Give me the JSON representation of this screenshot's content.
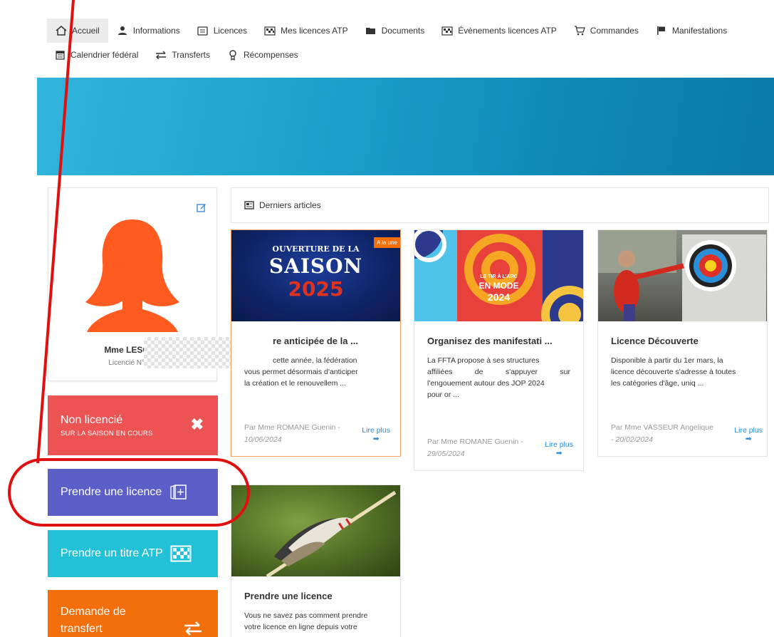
{
  "nav": {
    "items": [
      {
        "label": "Accueil",
        "icon": "home-icon"
      },
      {
        "label": "Informations",
        "icon": "user-icon"
      },
      {
        "label": "Licences",
        "icon": "card-icon"
      },
      {
        "label": "Mes licences ATP",
        "icon": "flag-checkered-icon"
      },
      {
        "label": "Documents",
        "icon": "folder-icon"
      },
      {
        "label": "Évènements licences ATP",
        "icon": "flag-checkered-icon"
      },
      {
        "label": "Commandes",
        "icon": "cart-icon"
      },
      {
        "label": "Manifestations",
        "icon": "flag-icon"
      },
      {
        "label": "Calendrier fédéral",
        "icon": "calendar-icon"
      },
      {
        "label": "Transferts",
        "icon": "exchange-icon"
      },
      {
        "label": "Récompenses",
        "icon": "medal-icon"
      }
    ]
  },
  "profile": {
    "name": "Mme LESCUY",
    "number": "Licencié N°102"
  },
  "actions": {
    "status_title": "Non licencié",
    "status_sub": "SUR LA SAISON EN COURS",
    "take_licence": "Prendre une licence",
    "take_atp": "Prendre un titre ATP",
    "transfer_line1": "Demande de",
    "transfer_line2": "transfert"
  },
  "articles": {
    "heading": "Derniers articles",
    "read_more": "Lire plus",
    "items": [
      {
        "title": "re anticipée de la ...",
        "desc_lines": [
          "cette année, la fédération",
          "vous permet désormais d'anticiper",
          "la création et le renouvellem ..."
        ],
        "author": "Par Mme ROMANE Guenin -",
        "date": "10/06/2024",
        "badge": "A la une",
        "image_text_1": "OUVERTURE DE LA",
        "image_text_2": "SAISON",
        "image_text_3": "2025"
      },
      {
        "title": "Organisez des manifestati ...",
        "desc_lines": [
          "La FFTA propose à ses structures",
          "affiliées de s'appuyer sur",
          "l'engouement autour des JOP 2024",
          "pour or ..."
        ],
        "author": "Par Mme ROMANE Guenin -",
        "date": "29/05/2024",
        "image_text_1": "LE TIR À L'ARC",
        "image_text_2": "EN MODE",
        "image_text_3": "2024"
      },
      {
        "title": "Licence Découverte",
        "desc_lines": [
          "Disponible à partir du 1er mars, la",
          "licence découverte s'adresse à toutes",
          "les catégories d'âge, uniq ..."
        ],
        "author": "Par Mme VASSEUR Angelique",
        "date": "- 20/02/2024"
      },
      {
        "title": "Prendre une licence",
        "desc_lines": [
          "Vous ne savez pas comment prendre",
          "votre licence en ligne depuis votre"
        ]
      }
    ]
  },
  "colors": {
    "red": "#ec5353",
    "blue": "#5b5fc7",
    "cyan": "#23c1d8",
    "orange": "#f36f0c",
    "avatar": "#ff5a1f",
    "annotation": "#e01010"
  }
}
